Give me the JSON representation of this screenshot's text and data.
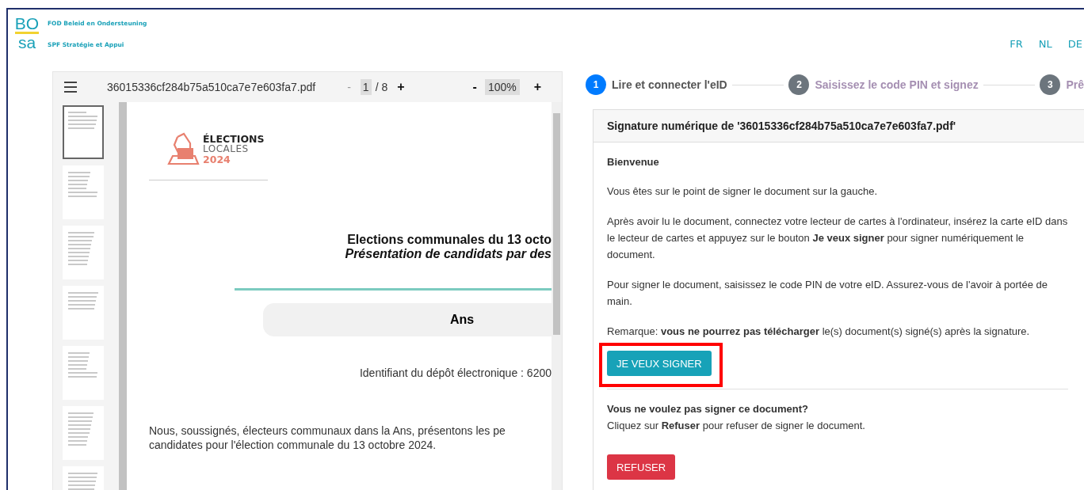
{
  "header": {
    "logo": {
      "top": "BO",
      "bottom": "sa"
    },
    "org_lines": [
      "FOD Beleid en Ondersteuning",
      "SPF Stratégie et Appui"
    ],
    "languages": [
      {
        "label": "FR",
        "selected": false
      },
      {
        "label": "NL",
        "selected": false
      },
      {
        "label": "DE",
        "selected": false
      }
    ]
  },
  "viewer": {
    "filename": "36015336cf284b75a510ca7e7e603fa7.pdf",
    "page_minus": "-",
    "page_current": "1",
    "page_total": "/ 8",
    "page_plus": "+",
    "zoom_minus": "-",
    "zoom": "100%",
    "zoom_plus": "+",
    "thumbnails": [
      {
        "selected": true
      },
      {
        "selected": false
      },
      {
        "selected": false
      },
      {
        "selected": false
      },
      {
        "selected": false
      },
      {
        "selected": false
      },
      {
        "selected": false
      }
    ],
    "document": {
      "logo_lines": [
        "ÉLECTIONS",
        "LOCALES",
        "2024"
      ],
      "title": "Elections communales du 13 octo",
      "subtitle": "Présentation de candidats par des",
      "commune": "Ans",
      "identifier": "Identifiant du dépôt électronique : 6200",
      "body": [
        "Nous, soussignés, électeurs communaux dans la Ans, présentons les pe",
        "candidates pour l'élection communale du 13 octobre 2024."
      ]
    }
  },
  "steps": [
    {
      "number": "1",
      "label": "Lire et connecter l'eID",
      "selected": true
    },
    {
      "number": "2",
      "label": "Saisissez le code PIN et signez",
      "selected": false
    },
    {
      "number": "3",
      "label": "Prê",
      "selected": false
    }
  ],
  "card": {
    "title": "Signature numérique de '36015336cf284b75a510ca7e7e603fa7.pdf'",
    "heading": "Bienvenue",
    "paragraphs": [
      "Vous êtes sur le point de signer le document sur la gauche.",
      "Après avoir lu le document, connectez votre lecteur de cartes à l'ordinateur, insérez la carte eID dans le lecteur de cartes et appuyez sur le bouton **Je veux signer** pour signer numériquement le document.",
      "Pour signer le document, saisissez le code PIN de votre eID. Assurez-vous de l'avoir à portée de main.",
      "Remarque: **vous ne pourrez pas télécharger** le(s) document(s) signé(s) après la signature."
    ],
    "sign_button": {
      "label": "JE VEUX SIGNER",
      "highlighted": true
    },
    "refuse_heading": "Vous ne voulez pas signer ce document?",
    "refuse_text": "Cliquez sur **Refuser** pour refuser de signer le document.",
    "refuse_button": {
      "label": "REFUSER"
    }
  }
}
